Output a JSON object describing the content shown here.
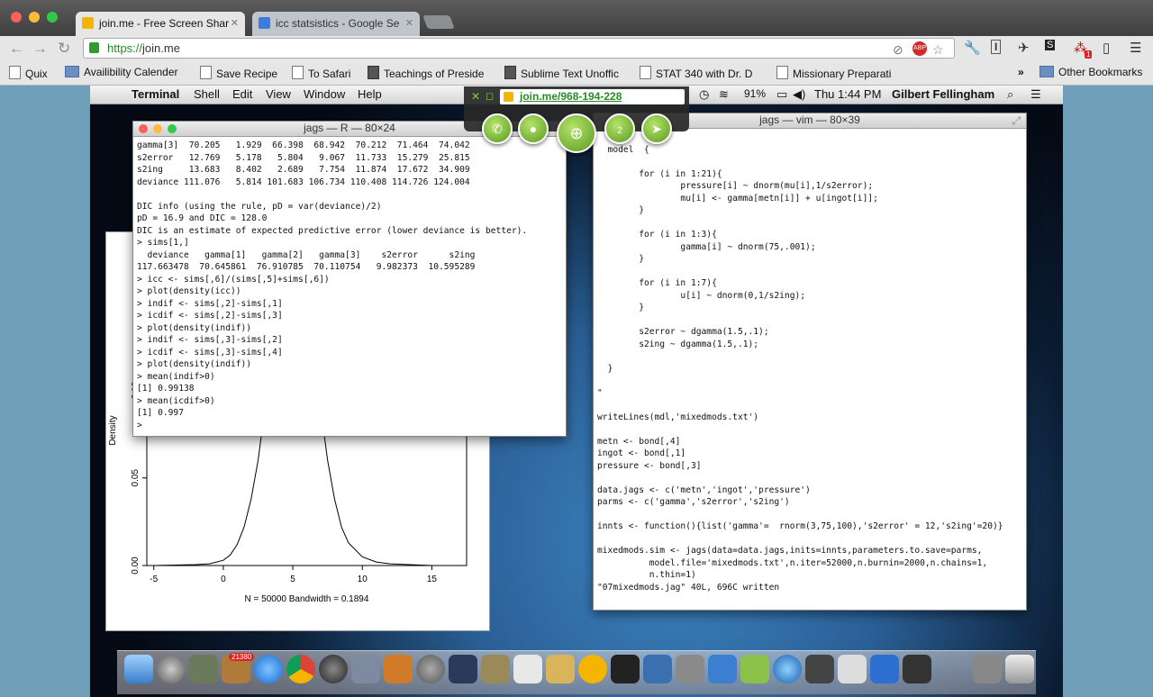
{
  "browser": {
    "tabs": [
      {
        "label": "join.me - Free Screen Shar",
        "active": true
      },
      {
        "label": "icc statsistics - Google Se",
        "active": false
      }
    ],
    "url_scheme": "https://",
    "url_host": "join.me",
    "bookmarks": [
      {
        "label": "Quix",
        "icon": "page-icon"
      },
      {
        "label": "Availibility Calender",
        "icon": "folder-icon"
      },
      {
        "label": "Save Recipe",
        "icon": "page-icon"
      },
      {
        "label": "To Safari",
        "icon": "page-icon"
      },
      {
        "label": "Teachings of Preside",
        "icon": "page-icon"
      },
      {
        "label": "Sublime Text Unoffic",
        "icon": "page-icon"
      },
      {
        "label": "STAT 340 with Dr. D",
        "icon": "page-icon"
      },
      {
        "label": "Missionary Preparati",
        "icon": "page-icon"
      }
    ],
    "other_bookmarks": "Other Bookmarks",
    "overflow": "»",
    "extension_badge": "1"
  },
  "mac": {
    "app_name": "Terminal",
    "menus": [
      "Shell",
      "Edit",
      "View",
      "Window",
      "Help"
    ],
    "battery": "91%",
    "clock": "Thu 1:44 PM",
    "user": "Gilbert Fellingham"
  },
  "joinme": {
    "link": "join.me/968-194-228",
    "participants": "2"
  },
  "r_console": {
    "title": "jags — R — 80×24",
    "lines": [
      "gamma[3]  70.205   1.929  66.398  68.942  70.212  71.464  74.042",
      "s2error   12.769   5.178   5.804   9.067  11.733  15.279  25.815",
      "s2ing     13.683   8.402   2.689   7.754  11.874  17.672  34.909",
      "deviance 111.076   5.814 101.683 106.734 110.408 114.726 124.004",
      "",
      "DIC info (using the rule, pD = var(deviance)/2)",
      "pD = 16.9 and DIC = 128.0",
      "DIC is an estimate of expected predictive error (lower deviance is better).",
      "> sims[1,]",
      "  deviance   gamma[1]   gamma[2]   gamma[3]    s2error      s2ing",
      "117.663478  70.645861  76.910785  70.110754   9.982373  10.595289",
      "> icc <- sims[,6]/(sims[,5]+sims[,6])",
      "> plot(density(icc))",
      "> indif <- sims[,2]-sims[,1]",
      "> icdif <- sims[,2]-sims[,3]",
      "> plot(density(indif))",
      "> indif <- sims[,3]-sims[,2]",
      "> icdif <- sims[,3]-sims[,4]",
      "> plot(density(indif))",
      "> mean(indif>0)",
      "[1] 0.99138",
      "> mean(icdif>0)",
      "[1] 0.997",
      "> "
    ]
  },
  "vim": {
    "title": "jags — vim — 80×39",
    "lines": [
      "",
      "  model  {",
      "",
      "        for (i in 1:21){",
      "                pressure[i] ~ dnorm(mu[i],1/s2error);",
      "                mu[i] <- gamma[metn[i]] + u[ingot[i]];",
      "        }",
      "",
      "        for (i in 1:3){",
      "                gamma[i] ~ dnorm(75,.001);",
      "        }",
      "",
      "        for (i in 1:7){",
      "                u[i] ~ dnorm(0,1/s2ing);",
      "        }",
      "",
      "        s2error ~ dgamma(1.5,.1);",
      "        s2ing ~ dgamma(1.5,.1);",
      "",
      "  }",
      "",
      "\"",
      "",
      "writeLines(mdl,'mixedmods.txt')",
      "",
      "metn <- bond[,4]",
      "ingot <- bond[,1]",
      "pressure <- bond[,3]",
      "",
      "data.jags <- c('metn','ingot','pressure')",
      "parms <- c('gamma','s2error','s2ing')",
      "",
      "innts <- function(){list('gamma'=  rnorm(3,75,100),'s2error' = 12,'s2ing'=20)}",
      "",
      "mixedmods.sim <- jags(data=data.jags,inits=innts,parameters.to.save=parms,",
      "          model.file='mixedmods.txt',n.iter=52000,n.burnin=2000,n.chains=1,",
      "          n.thin=1)",
      "\"07mixedmods.jag\" 40L, 696C written"
    ]
  },
  "plot": {
    "ylabel": "Density",
    "xlabel": "N = 50000   Bandwidth = 0.1894",
    "x_ticks": [
      "-5",
      "0",
      "5",
      "10",
      "15"
    ],
    "y_ticks": [
      "0.00",
      "0.05",
      "0.10"
    ]
  },
  "chart_data": {
    "type": "line",
    "title": "",
    "xlabel": "N = 50000   Bandwidth = 0.1894",
    "ylabel": "Density",
    "xlim": [
      -5.5,
      17.5
    ],
    "ylim": [
      0,
      0.18
    ],
    "x": [
      -5,
      -2,
      -1,
      0,
      0.5,
      1,
      1.5,
      2,
      2.5,
      3,
      3.5,
      4,
      4.5,
      5,
      5.5,
      6,
      6.5,
      7,
      7.5,
      8,
      8.5,
      9,
      10,
      11,
      12,
      15,
      17
    ],
    "y": [
      0.0,
      0.0005,
      0.001,
      0.003,
      0.006,
      0.012,
      0.022,
      0.038,
      0.06,
      0.09,
      0.12,
      0.15,
      0.165,
      0.17,
      0.165,
      0.15,
      0.12,
      0.09,
      0.06,
      0.038,
      0.022,
      0.013,
      0.005,
      0.002,
      0.001,
      0.0,
      0.0
    ]
  },
  "dock": {
    "badge": "21380"
  }
}
